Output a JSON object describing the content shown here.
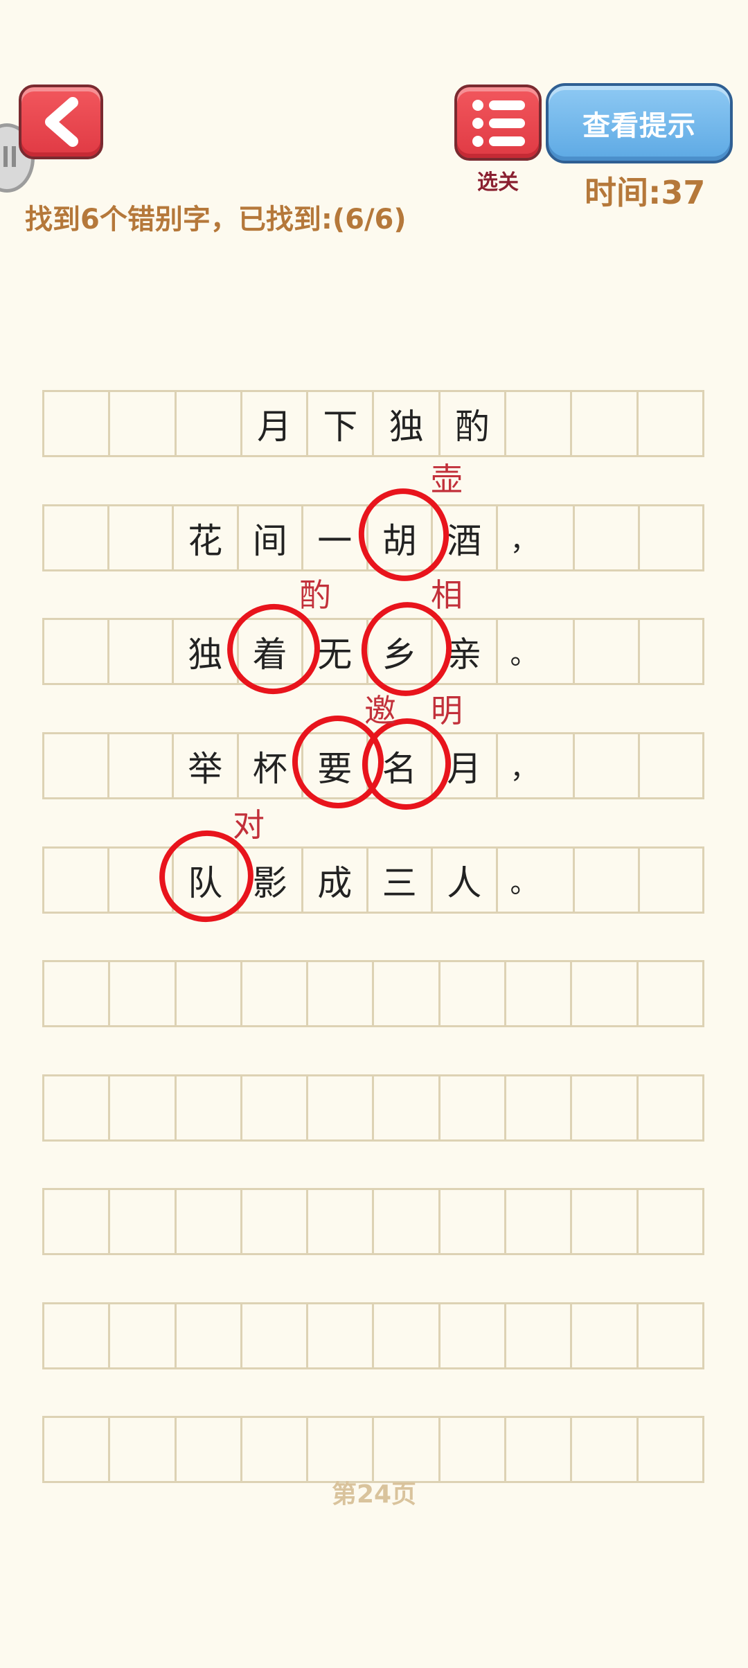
{
  "toolbar": {
    "back_icon": "chevron-left-icon",
    "menu_icon": "list-icon",
    "menu_label": "选关",
    "hint_label": "查看提示",
    "timer": "时间:37"
  },
  "status": "找到6个错别字，已找到:(6/6)",
  "poem_rows": [
    [
      "",
      "",
      "",
      "月",
      "下",
      "独",
      "酌",
      "",
      "",
      ""
    ],
    [
      "",
      "",
      "花",
      "间",
      "一",
      "胡",
      "酒",
      "，",
      "",
      ""
    ],
    [
      "",
      "",
      "独",
      "着",
      "无",
      "乡",
      "亲",
      "。",
      "",
      ""
    ],
    [
      "",
      "",
      "举",
      "杯",
      "要",
      "名",
      "月",
      "，",
      "",
      ""
    ],
    [
      "",
      "",
      "队",
      "影",
      "成",
      "三",
      "人",
      "。",
      "",
      ""
    ],
    [
      "",
      "",
      "",
      "",
      "",
      "",
      "",
      "",
      "",
      ""
    ],
    [
      "",
      "",
      "",
      "",
      "",
      "",
      "",
      "",
      "",
      ""
    ],
    [
      "",
      "",
      "",
      "",
      "",
      "",
      "",
      "",
      "",
      ""
    ],
    [
      "",
      "",
      "",
      "",
      "",
      "",
      "",
      "",
      "",
      ""
    ],
    [
      "",
      "",
      "",
      "",
      "",
      "",
      "",
      "",
      "",
      ""
    ]
  ],
  "corrections": [
    {
      "wrong": "胡",
      "right": "壶"
    },
    {
      "wrong": "着",
      "right": "酌"
    },
    {
      "wrong": "乡",
      "right": "相"
    },
    {
      "wrong": "要",
      "right": "邀"
    },
    {
      "wrong": "名",
      "right": "明"
    },
    {
      "wrong": "队",
      "right": "对"
    }
  ],
  "colors": {
    "circle": "#e8141c",
    "correction_text": "#c2303a",
    "accent_brown": "#b5783a"
  },
  "page_label": "第24页"
}
